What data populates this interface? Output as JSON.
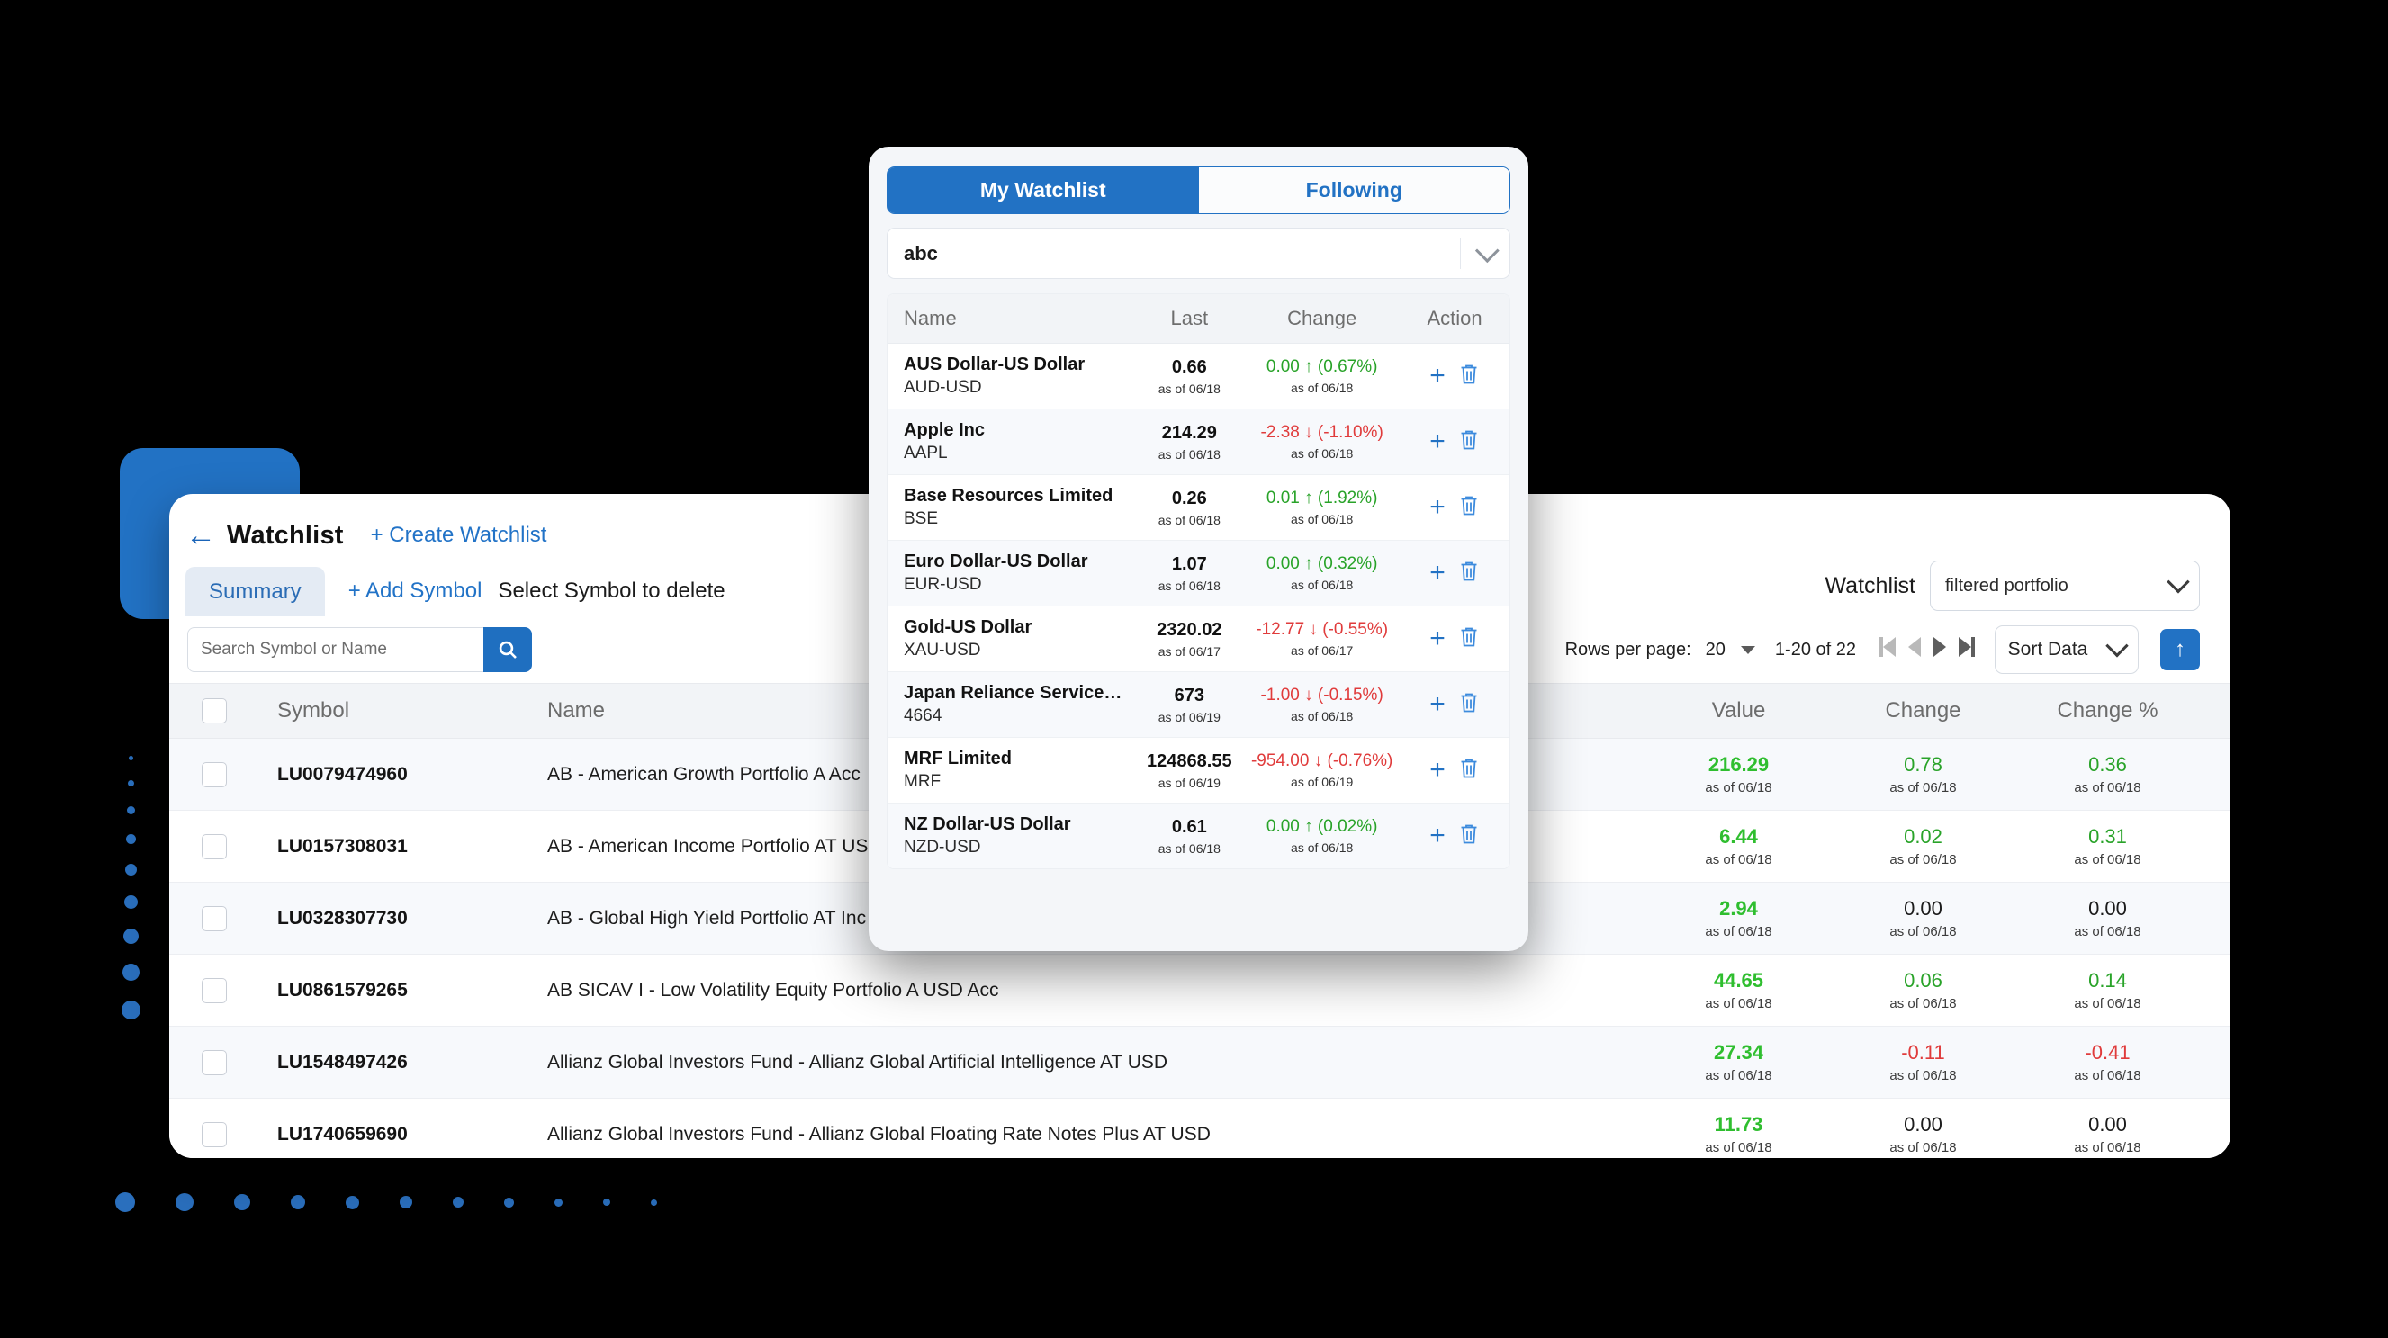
{
  "app": {
    "title": "Watchlist",
    "back_icon": "back-arrow-icon",
    "create_watchlist": "+ Create Watchlist",
    "tab_summary": "Summary",
    "add_symbol": "+ Add Symbol",
    "select_to_delete": "Select Symbol to delete",
    "watchlist_label": "Watchlist",
    "watchlist_value": "filtered portfolio"
  },
  "toolbar": {
    "search_placeholder": "Search Symbol or Name",
    "search_value": "",
    "rows_per_page_label": "Rows per page:",
    "rows_per_page_value": "20",
    "page_range": "1-20 of 22",
    "sort_label": "Sort Data",
    "scroll_top_icon": "arrow-up-icon"
  },
  "table": {
    "columns": [
      "Symbol",
      "Name",
      "Value",
      "Change",
      "Change %"
    ],
    "rows": [
      {
        "symbol": "LU0079474960",
        "name": "AB - American Growth Portfolio A Acc",
        "value": "216.29",
        "value_tone": "pos-strong",
        "value_asof": "as of 06/18",
        "change": "0.78",
        "change_tone": "pos",
        "change_asof": "as of 06/18",
        "change_pct": "0.36",
        "change_pct_tone": "pos",
        "change_pct_asof": "as of 06/18"
      },
      {
        "symbol": "LU0157308031",
        "name": "AB - American Income Portfolio AT USD",
        "value": "6.44",
        "value_tone": "pos-strong",
        "value_asof": "as of 06/18",
        "change": "0.02",
        "change_tone": "pos",
        "change_asof": "as of 06/18",
        "change_pct": "0.31",
        "change_pct_tone": "pos",
        "change_pct_asof": "as of 06/18"
      },
      {
        "symbol": "LU0328307730",
        "name": "AB - Global High Yield Portfolio AT Inc",
        "value": "2.94",
        "value_tone": "pos-strong",
        "value_asof": "as of 06/18",
        "change": "0.00",
        "change_tone": "neu",
        "change_asof": "as of 06/18",
        "change_pct": "0.00",
        "change_pct_tone": "neu",
        "change_pct_asof": "as of 06/18"
      },
      {
        "symbol": "LU0861579265",
        "name": "AB SICAV I - Low Volatility Equity Portfolio A USD Acc",
        "value": "44.65",
        "value_tone": "pos-strong",
        "value_asof": "as of 06/18",
        "change": "0.06",
        "change_tone": "pos",
        "change_asof": "as of 06/18",
        "change_pct": "0.14",
        "change_pct_tone": "pos",
        "change_pct_asof": "as of 06/18"
      },
      {
        "symbol": "LU1548497426",
        "name": "Allianz Global Investors Fund - Allianz Global Artificial Intelligence AT USD",
        "value": "27.34",
        "value_tone": "pos-strong",
        "value_asof": "as of 06/18",
        "change": "-0.11",
        "change_tone": "neg",
        "change_asof": "as of 06/18",
        "change_pct": "-0.41",
        "change_pct_tone": "neg",
        "change_pct_asof": "as of 06/18"
      },
      {
        "symbol": "LU1740659690",
        "name": "Allianz Global Investors Fund - Allianz Global Floating Rate Notes Plus AT USD",
        "value": "11.73",
        "value_tone": "pos-strong",
        "value_asof": "as of 06/18",
        "change": "0.00",
        "change_tone": "neu",
        "change_asof": "as of 06/18",
        "change_pct": "0.00",
        "change_pct_tone": "neu",
        "change_pct_asof": "as of 06/18"
      }
    ]
  },
  "popup": {
    "tab_my_watchlist": "My Watchlist",
    "tab_following": "Following",
    "selected_watchlist": "abc",
    "columns": [
      "Name",
      "Last",
      "Change",
      "Action"
    ],
    "rows": [
      {
        "name": "AUS Dollar-US Dollar",
        "ticker": "AUD-USD",
        "last": "0.66",
        "last_asof": "as of 06/18",
        "change": "0.00",
        "dir": "up",
        "pct": "(0.67%)",
        "tone": "pos",
        "change_asof": "as of 06/18"
      },
      {
        "name": "Apple Inc",
        "ticker": "AAPL",
        "last": "214.29",
        "last_asof": "as of 06/18",
        "change": "-2.38",
        "dir": "down",
        "pct": "(-1.10%)",
        "tone": "neg",
        "change_asof": "as of 06/18"
      },
      {
        "name": "Base Resources Limited",
        "ticker": "BSE",
        "last": "0.26",
        "last_asof": "as of 06/18",
        "change": "0.01",
        "dir": "up",
        "pct": "(1.92%)",
        "tone": "pos",
        "change_asof": "as of 06/18"
      },
      {
        "name": "Euro Dollar-US Dollar",
        "ticker": "EUR-USD",
        "last": "1.07",
        "last_asof": "as of 06/18",
        "change": "0.00",
        "dir": "up",
        "pct": "(0.32%)",
        "tone": "pos",
        "change_asof": "as of 06/18"
      },
      {
        "name": "Gold-US Dollar",
        "ticker": "XAU-USD",
        "last": "2320.02",
        "last_asof": "as of 06/17",
        "change": "-12.77",
        "dir": "down",
        "pct": "(-0.55%)",
        "tone": "neg",
        "change_asof": "as of 06/17"
      },
      {
        "name": "Japan Reliance Service…",
        "ticker": "4664",
        "last": "673",
        "last_asof": "as of 06/19",
        "change": "-1.00",
        "dir": "down",
        "pct": "(-0.15%)",
        "tone": "neg",
        "change_asof": "as of 06/18"
      },
      {
        "name": "MRF Limited",
        "ticker": "MRF",
        "last": "124868.55",
        "last_asof": "as of 06/19",
        "change": "-954.00",
        "dir": "down",
        "pct": "(-0.76%)",
        "tone": "neg",
        "change_asof": "as of 06/19"
      },
      {
        "name": "NZ Dollar-US Dollar",
        "ticker": "NZD-USD",
        "last": "0.61",
        "last_asof": "as of 06/18",
        "change": "0.00",
        "dir": "up",
        "pct": "(0.02%)",
        "tone": "pos",
        "change_asof": "as of 06/18"
      }
    ],
    "add_icon": "plus-icon",
    "delete_icon": "trash-icon"
  },
  "colors": {
    "accent": "#2272c4",
    "positive": "#29a329",
    "positive_strong": "#2fbe2f",
    "negative": "#e03b3b",
    "background": "#000000"
  }
}
